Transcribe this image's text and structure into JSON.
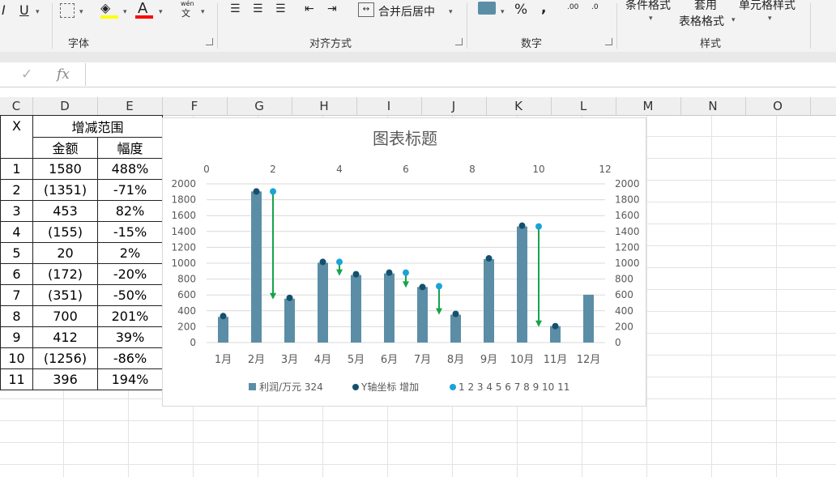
{
  "ribbon": {
    "font_group": "字体",
    "align_group": "对齐方式",
    "number_group": "数字",
    "styles_group": "样式",
    "merge_label": "合并后居中",
    "percent": "%",
    "comma": ",",
    "cond_format": "条件格式",
    "apply_table_1": "套用",
    "apply_table_2": "表格格式",
    "cell_styles": "单元格样式",
    "wen_top": "wén",
    "wen_bottom": "文",
    "underline": "U",
    "italic": "I",
    "font_color_letter": "A",
    "inc_decimal": ".00",
    "dec_decimal": ".0",
    "colors": {
      "highlight": "#ffff00",
      "font_color": "#ff0000"
    }
  },
  "formula_bar": {
    "check": "✓",
    "fx": "fx",
    "value": ""
  },
  "columns": [
    "C",
    "D",
    "E",
    "F",
    "G",
    "H",
    "I",
    "J",
    "K",
    "L",
    "M",
    "N",
    "O"
  ],
  "table": {
    "header_x": "X",
    "header_range": "增减范围",
    "sub_amount": "金额",
    "sub_percent": "幅度",
    "rows": [
      {
        "x": "1",
        "amount": "1580",
        "pct": "488%",
        "neg": false
      },
      {
        "x": "2",
        "amount": "(1351)",
        "pct": "-71%",
        "neg": true
      },
      {
        "x": "3",
        "amount": "453",
        "pct": "82%",
        "neg": false
      },
      {
        "x": "4",
        "amount": "(155)",
        "pct": "-15%",
        "neg": true
      },
      {
        "x": "5",
        "amount": "20",
        "pct": "2%",
        "neg": false
      },
      {
        "x": "6",
        "amount": "(172)",
        "pct": "-20%",
        "neg": true
      },
      {
        "x": "7",
        "amount": "(351)",
        "pct": "-50%",
        "neg": true
      },
      {
        "x": "8",
        "amount": "700",
        "pct": "201%",
        "neg": false
      },
      {
        "x": "9",
        "amount": "412",
        "pct": "39%",
        "neg": false
      },
      {
        "x": "10",
        "amount": "(1256)",
        "pct": "-86%",
        "neg": true
      },
      {
        "x": "11",
        "amount": "396",
        "pct": "194%",
        "neg": false
      }
    ]
  },
  "chart_data": {
    "type": "bar",
    "title": "图表标题",
    "categories": [
      "1月",
      "2月",
      "3月",
      "4月",
      "5月",
      "6月",
      "7月",
      "8月",
      "9月",
      "10月",
      "11月",
      "12月"
    ],
    "ylim": [
      0,
      2000
    ],
    "yticks": [
      "0",
      "200",
      "400",
      "600",
      "800",
      "1000",
      "1200",
      "1400",
      "1600",
      "1800",
      "2000"
    ],
    "x2lim": [
      0,
      12
    ],
    "x2ticks": [
      "0",
      "2",
      "4",
      "6",
      "8",
      "10",
      "12"
    ],
    "series": [
      {
        "name": "利润/万元 324",
        "type": "bar",
        "color": "#5b8ea6",
        "values": [
          324,
          1904,
          553,
          1006,
          851,
          871,
          700,
          351,
          1051,
          1463,
          207,
          603
        ]
      },
      {
        "name": "Y轴坐标 增加",
        "type": "scatter",
        "color": "#14506e",
        "x": [
          0.5,
          1.5,
          2.5,
          3.5,
          4.5,
          5.5,
          6.5,
          7.5,
          8.5,
          9.5,
          10.5
        ],
        "y": [
          334,
          1904,
          563,
          1016,
          861,
          881,
          700,
          361,
          1061,
          1473,
          207
        ]
      },
      {
        "name": "1 2 3 4 5 6 7 8 9 10 11",
        "type": "scatter",
        "color": "#1aa3d9",
        "x": [
          2,
          4,
          6,
          7,
          10
        ],
        "y": [
          1904,
          1016,
          881,
          710,
          1463
        ]
      }
    ],
    "arrows": {
      "color": "#16a34a",
      "x": [
        2,
        4,
        6,
        7,
        10
      ],
      "from": [
        1904,
        1016,
        881,
        710,
        1463
      ],
      "to": [
        553,
        851,
        700,
        361,
        207
      ]
    },
    "grid": true,
    "legend": "bottom"
  }
}
